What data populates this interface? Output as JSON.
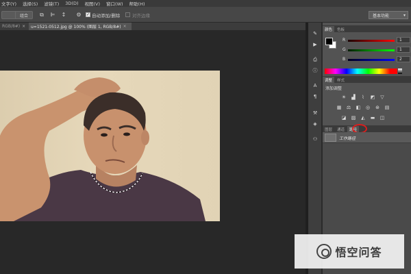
{
  "menubar": {
    "items": [
      "文字(Y)",
      "选择(S)",
      "滤镜(T)",
      "3D(D)",
      "视图(V)",
      "窗口(W)",
      "帮助(H)"
    ]
  },
  "options_bar": {
    "btn1_label": "",
    "btn2_label": "组合",
    "auto_add_delete_label": "自动添加/删除",
    "align_edges_label": "对齐边缘",
    "auto_add_delete_checked": true,
    "workspace": "基本功能"
  },
  "document_tabs": [
    {
      "label": "RGB/8#)"
    },
    {
      "label": "u=1521-0512.jpg @ 100% (图层 1, RGB/8#)"
    }
  ],
  "panels": {
    "color": {
      "tabs": [
        "颜色",
        "色板"
      ],
      "channels": [
        {
          "letter": "R",
          "value": "1",
          "color": "#d23b3b"
        },
        {
          "letter": "G",
          "value": "1",
          "color": "#2eae3a"
        },
        {
          "letter": "B",
          "value": "2",
          "color": "#3a58d6"
        }
      ]
    },
    "adjustments": {
      "tabs": [
        "调整",
        "样式"
      ],
      "title": "添加调整"
    },
    "layers": {
      "tabs": [
        "图层",
        "通道",
        "路径"
      ],
      "highlight_color": "#d81e1e",
      "rows": [
        {
          "name": "工作路径"
        }
      ]
    }
  },
  "watermark": {
    "text": "悟空问答"
  }
}
